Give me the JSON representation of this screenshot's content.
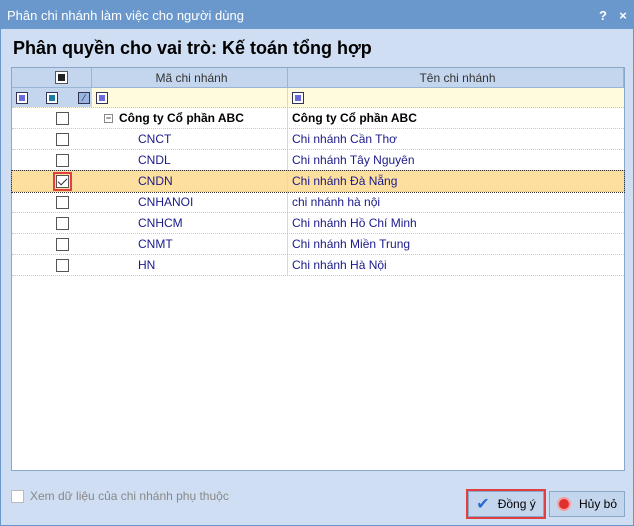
{
  "window": {
    "title": "Phân chi nhánh làm việc cho người dùng",
    "help": "?",
    "close": "×"
  },
  "heading": "Phân quyền cho vai trò: Kế toán tổng hợp",
  "grid": {
    "columns": [
      "Mã chi nhánh",
      "Tên chi nhánh"
    ],
    "rows": [
      {
        "code": "Công ty Cổ phần ABC",
        "name": "Công ty Cổ phần ABC",
        "checked": false,
        "group": true
      },
      {
        "code": "CNCT",
        "name": "Chi nhánh Cần Thơ",
        "checked": false
      },
      {
        "code": "CNDL",
        "name": "Chi nhánh Tây Nguyên",
        "checked": false
      },
      {
        "code": "CNDN",
        "name": "Chi nhánh Đà Nẵng",
        "checked": true,
        "selected": true
      },
      {
        "code": "CNHANOI",
        "name": "chi nhánh hà nội",
        "checked": false
      },
      {
        "code": "CNHCM",
        "name": "Chi nhánh Hồ Chí Minh",
        "checked": false
      },
      {
        "code": "CNMT",
        "name": "Chi nhánh Miền Trung",
        "checked": false
      },
      {
        "code": "HN",
        "name": "Chi nhánh Hà Nội",
        "checked": false
      }
    ]
  },
  "footer": {
    "include_sub_label": "Xem dữ liệu của chi nhánh phụ thuộc",
    "ok": "Đồng ý",
    "cancel": "Hủy bỏ"
  }
}
